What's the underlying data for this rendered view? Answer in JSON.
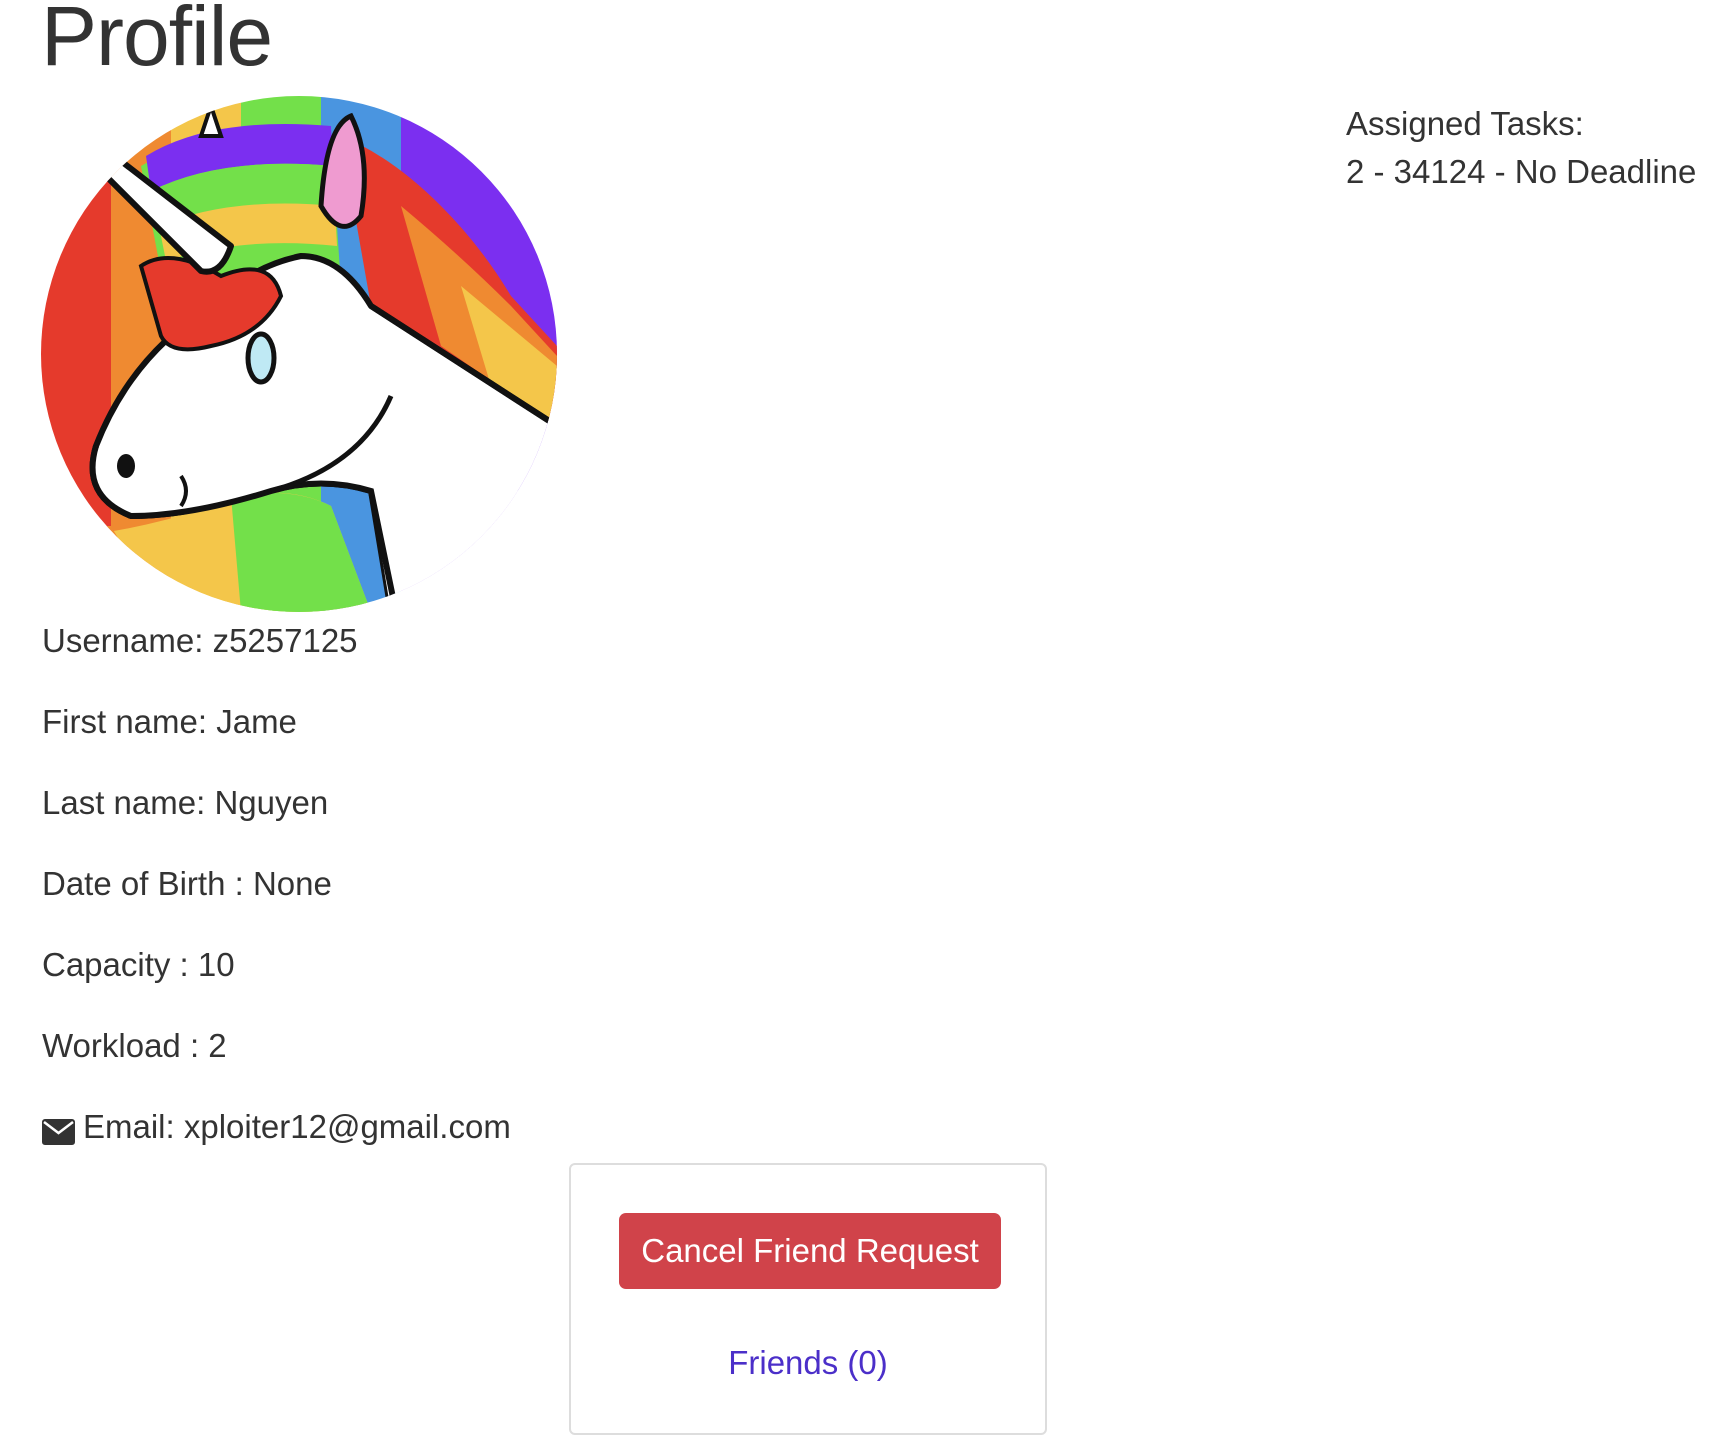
{
  "page": {
    "title": "Profile"
  },
  "avatar": {
    "description_icon": "unicorn-avatar"
  },
  "profile": {
    "username_label": "Username:",
    "username_value": "z5257125",
    "first_name_label": "First name:",
    "first_name_value": "Jame",
    "last_name_label": "Last name:",
    "last_name_value": "Nguyen",
    "dob_label": "Date of Birth :",
    "dob_value": "None",
    "capacity_label": "Capacity :",
    "capacity_value": "10",
    "workload_label": "Workload :",
    "workload_value": "2",
    "email_icon": "envelope-icon",
    "email_label": "Email:",
    "email_value": "xploiter12@gmail.com"
  },
  "tasks": {
    "heading": "Assigned Tasks:",
    "items": [
      "2 - 34124 - No Deadline"
    ]
  },
  "friend_card": {
    "cancel_label": "Cancel Friend Request",
    "friends_link": "Friends (0)"
  },
  "colors": {
    "text": "#333333",
    "danger": "#d0434a",
    "link": "#4b2fc9",
    "card_border": "#dddddd"
  }
}
